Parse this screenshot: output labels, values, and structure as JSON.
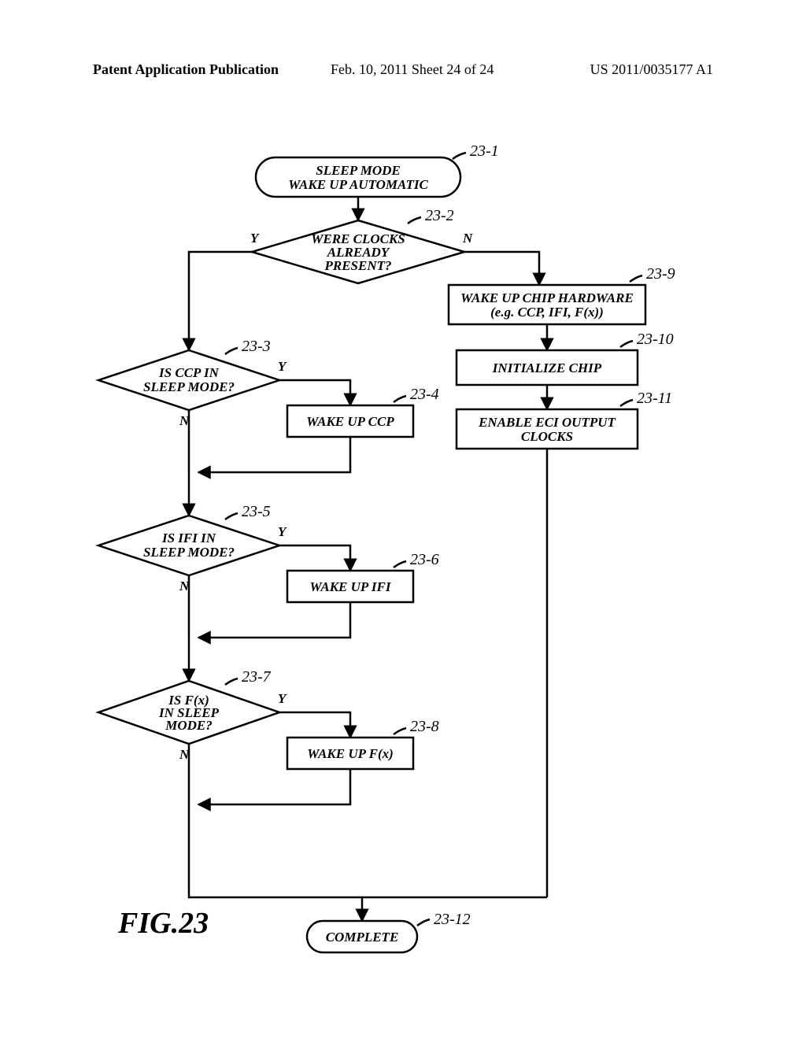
{
  "header": {
    "left": "Patent Application Publication",
    "mid": "Feb. 10, 2011  Sheet 24 of 24",
    "right": "US 2011/0035177 A1"
  },
  "fig_label": "FIG.23",
  "nodes": {
    "start": {
      "l1": "SLEEP MODE",
      "l2": "WAKE UP AUTOMATIC",
      "ref": "23-1"
    },
    "d_clocks": {
      "l1": "WERE CLOCKS",
      "l2": "ALREADY",
      "l3": "PRESENT?",
      "ref": "23-2",
      "y": "Y",
      "n": "N"
    },
    "d_ccp": {
      "l1": "IS CCP IN",
      "l2": "SLEEP MODE?",
      "ref": "23-3",
      "y": "Y",
      "n": "N"
    },
    "p_ccp": {
      "l1": "WAKE UP CCP",
      "ref": "23-4"
    },
    "d_ifi": {
      "l1": "IS IFI IN",
      "l2": "SLEEP MODE?",
      "ref": "23-5",
      "y": "Y",
      "n": "N"
    },
    "p_ifi": {
      "l1": "WAKE UP IFI",
      "ref": "23-6"
    },
    "d_fx": {
      "l1": "IS F(x)",
      "l2": "IN SLEEP",
      "l3": "MODE?",
      "ref": "23-7",
      "y": "Y",
      "n": "N"
    },
    "p_fx": {
      "l1": "WAKE UP F(x)",
      "ref": "23-8"
    },
    "p_hw": {
      "l1": "WAKE UP CHIP HARDWARE",
      "l2": "(e.g. CCP, IFI, F(x))",
      "ref": "23-9"
    },
    "p_init": {
      "l1": "INITIALIZE CHIP",
      "ref": "23-10"
    },
    "p_eci": {
      "l1": "ENABLE ECI OUTPUT",
      "l2": "CLOCKS",
      "ref": "23-11"
    },
    "end": {
      "l1": "COMPLETE",
      "ref": "23-12"
    }
  }
}
